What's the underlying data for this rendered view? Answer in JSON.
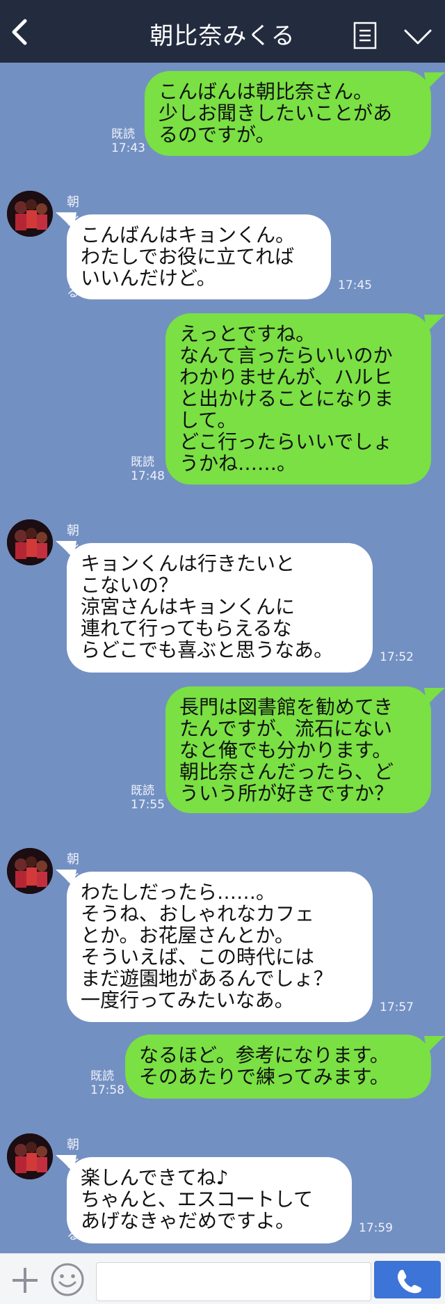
{
  "header": {
    "title": "朝比奈みくる"
  },
  "contact": {
    "name": "朝比奈みくる"
  },
  "colors": {
    "header_bg": "#232b3e",
    "chat_bg": "#7390c2",
    "my_bubble": "#7ae043",
    "their_bubble": "#ffffff",
    "call_button": "#3d74d8"
  },
  "icons": {
    "back": "chevron-left-icon",
    "menu": "list-icon",
    "collapse": "chevron-down-icon",
    "plus": "plus-icon",
    "emoji": "smiley-icon",
    "call": "phone-icon"
  },
  "messages": [
    {
      "from": "me",
      "text": "こんばんは朝比奈さん。\n少しお聞きしたいことがあ\nるのですが。",
      "read": "既読",
      "time": "17:43"
    },
    {
      "from": "them",
      "name": "朝比奈みくる",
      "text": "こんばんはキョンくん。\nわたしでお役に立てれば\nいいんだけど。",
      "time": "17:45"
    },
    {
      "from": "me",
      "text": "えっとですね。\nなんて言ったらいいのか\nわかりませんが、ハルヒ\nと出かけることになりま\nして。\nどこ行ったらいいでしょ\nうかね……。",
      "read": "既読",
      "time": "17:48"
    },
    {
      "from": "them",
      "name": "朝比奈みくる",
      "text": "キョンくんは行きたいと\nこないの？\n涼宮さんはキョンくんに\n連れて行ってもらえるな\nらどこでも喜ぶと思うなあ。",
      "time": "17:52"
    },
    {
      "from": "me",
      "text": "長門は図書館を勧めてき\nたんですが、流石にない\nなと俺でも分かります。\n朝比奈さんだったら、ど\nういう所が好きですか？",
      "read": "既読",
      "time": "17:55"
    },
    {
      "from": "them",
      "name": "朝比奈みくる",
      "text": "わたしだったら……。\nそうね、おしゃれなカフェ\nとか。お花屋さんとか。\nそういえば、この時代には\nまだ遊園地があるんでしょ？\n一度行ってみたいなあ。",
      "time": "17:57"
    },
    {
      "from": "me",
      "text": "なるほど。参考になります。\nそのあたりで練ってみます。",
      "read": "既読",
      "time": "17:58"
    },
    {
      "from": "them",
      "name": "朝比奈みくる",
      "text": "楽しんできてね♪\nちゃんと、エスコートして\nあげなきゃだめですよ。",
      "time": "17:59"
    }
  ],
  "footer": {
    "input_value": ""
  }
}
